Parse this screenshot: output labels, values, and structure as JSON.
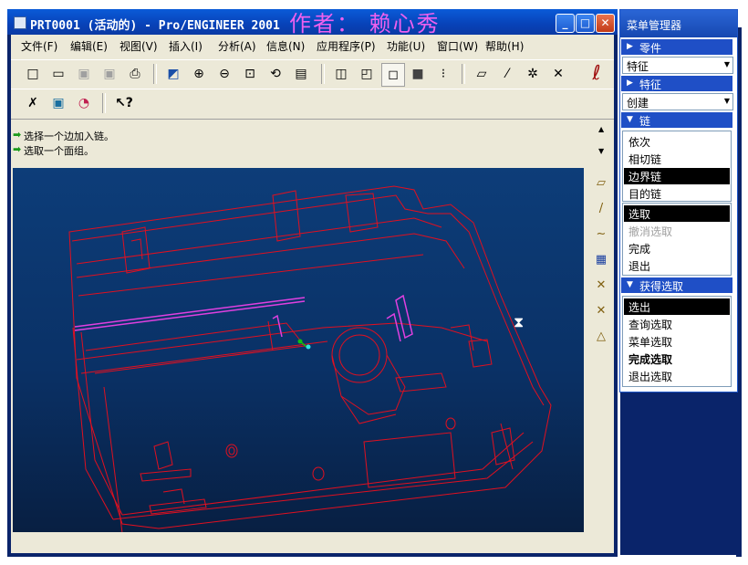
{
  "window": {
    "title": "PRT0001 (活动的) - Pro/ENGINEER 2001",
    "author_overlay": "作者： 赖心秀",
    "controls": {
      "minimize": "_",
      "restore": "□",
      "close": "✕"
    }
  },
  "menubar": [
    {
      "label": "文件(F)"
    },
    {
      "label": "编辑(E)"
    },
    {
      "label": "视图(V)"
    },
    {
      "label": "插入(I)"
    },
    {
      "label": "分析(A)"
    },
    {
      "label": "信息(N)"
    },
    {
      "label": "应用程序(P)"
    },
    {
      "label": "功能(U)"
    },
    {
      "label": "窗口(W)"
    },
    {
      "label": "帮助(H)"
    }
  ],
  "toolbar1": [
    {
      "icon": "new-file-icon",
      "glyph": "□"
    },
    {
      "icon": "open-folder-icon",
      "glyph": "▭"
    },
    {
      "icon": "save-icon",
      "glyph": "▣"
    },
    {
      "icon": "save-copy-icon",
      "glyph": "▣"
    },
    {
      "icon": "print-icon",
      "glyph": "⎙"
    },
    {
      "icon": "repaint-icon",
      "glyph": "◩"
    },
    {
      "icon": "zoom-in-icon",
      "glyph": "⊕"
    },
    {
      "icon": "zoom-out-icon",
      "glyph": "⊖"
    },
    {
      "icon": "refit-icon",
      "glyph": "⊡"
    },
    {
      "icon": "orient-icon",
      "glyph": "⟲"
    },
    {
      "icon": "saved-views-icon",
      "glyph": "▤"
    },
    {
      "icon": "wireframe-icon",
      "glyph": "◫"
    },
    {
      "icon": "hidden-line-icon",
      "glyph": "◰"
    },
    {
      "icon": "no-hidden-icon",
      "glyph": "◻"
    },
    {
      "icon": "shading-icon",
      "glyph": "■"
    },
    {
      "icon": "model-tree-icon",
      "glyph": "⁝"
    },
    {
      "icon": "datum-planes-icon",
      "glyph": "▱"
    },
    {
      "icon": "datum-axes-icon",
      "glyph": "⁄"
    },
    {
      "icon": "datum-points-icon",
      "glyph": "✲"
    },
    {
      "icon": "coord-sys-icon",
      "glyph": "✕"
    },
    {
      "icon": "context-help-logo-icon",
      "glyph": "ℓ"
    }
  ],
  "toolbar2": [
    {
      "icon": "select-tool-icon",
      "glyph": "✗"
    },
    {
      "icon": "smart-select-icon",
      "glyph": "▣"
    },
    {
      "icon": "spin-center-icon",
      "glyph": "◔"
    },
    {
      "icon": "whats-this-icon",
      "glyph": "↖?"
    }
  ],
  "messages": [
    {
      "text": "选择一个边加入链。"
    },
    {
      "text": "选取一个面组。"
    }
  ],
  "right_tools": [
    {
      "icon": "datum-plane-tool-icon",
      "glyph": "▱"
    },
    {
      "icon": "datum-axis-tool-icon",
      "glyph": "/"
    },
    {
      "icon": "datum-curve-tool-icon",
      "glyph": "∼"
    },
    {
      "icon": "datum-point-tool-icon",
      "glyph": "▦"
    },
    {
      "icon": "coord-sys-tool-icon",
      "glyph": "✕"
    },
    {
      "icon": "offset-point-tool-icon",
      "glyph": "✕"
    },
    {
      "icon": "analysis-tool-icon",
      "glyph": "△"
    }
  ],
  "menu_manager": {
    "title": "菜单管理器",
    "part_header": "零件",
    "part_value": "特征",
    "feature_header": "特征",
    "feature_value": "创建",
    "chain_header": "链",
    "chain_items": [
      {
        "label": "依次",
        "state": "normal"
      },
      {
        "label": "相切链",
        "state": "normal"
      },
      {
        "label": "边界链",
        "state": "selected"
      },
      {
        "label": "目的链",
        "state": "normal"
      }
    ],
    "chain_actions": [
      {
        "label": "选取",
        "state": "selected"
      },
      {
        "label": "撤消选取",
        "state": "disabled"
      },
      {
        "label": "完成",
        "state": "normal"
      },
      {
        "label": "退出",
        "state": "normal"
      }
    ],
    "getsel_header": "获得选取",
    "getsel_items": [
      {
        "label": "选出",
        "state": "selected"
      },
      {
        "label": "查询选取",
        "state": "normal"
      },
      {
        "label": "菜单选取",
        "state": "normal"
      },
      {
        "label": "完成选取",
        "state": "bold"
      },
      {
        "label": "退出选取",
        "state": "normal"
      }
    ]
  },
  "colors": {
    "model_wire": "#e01020",
    "highlight": "#e040e0",
    "background_top": "#0d3d79",
    "background_bottom": "#081f42"
  }
}
